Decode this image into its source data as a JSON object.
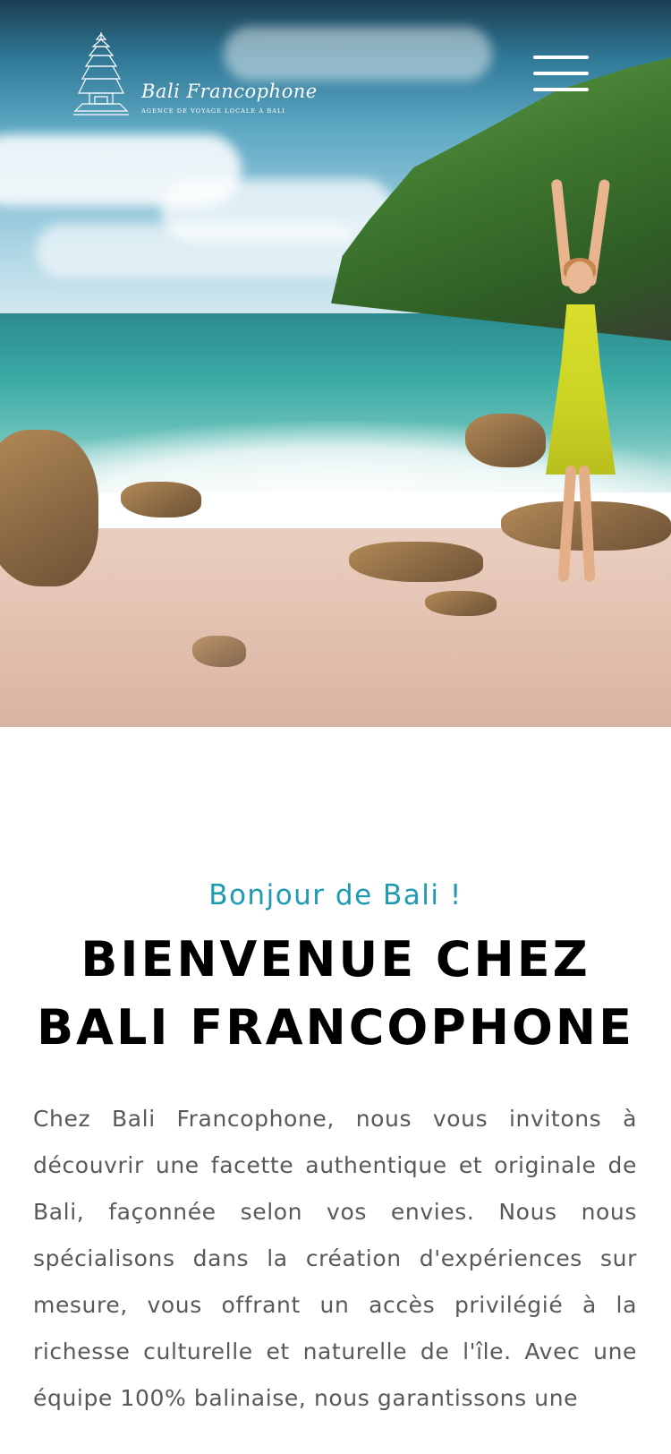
{
  "header": {
    "logo": {
      "brand_name": "Bali Francophone",
      "tagline": "AGENCE DE VOYAGE LOCALE À BALI",
      "icon": "temple-pagoda-icon"
    },
    "menu_icon": "hamburger-menu-icon"
  },
  "hero": {
    "image_description": "beach-with-woman-in-yellow-dress"
  },
  "intro": {
    "greeting": "Bonjour de Bali !",
    "title_line1": "BIENVENUE CHEZ",
    "title_line2": "BALI FRANCOPHONE",
    "body": "Chez Bali Francophone, nous vous invitons à découvrir une facette authentique et originale de Bali, façonnée selon vos envies. Nous nous spécialisons dans la création d'expériences sur mesure, vous offrant un accès privilégié à la richesse culturelle et naturelle de l'île. Avec une équipe 100% balinaise, nous garantissons une"
  },
  "colors": {
    "accent": "#1e9ab3",
    "title": "#000000",
    "body_text": "#595959"
  }
}
